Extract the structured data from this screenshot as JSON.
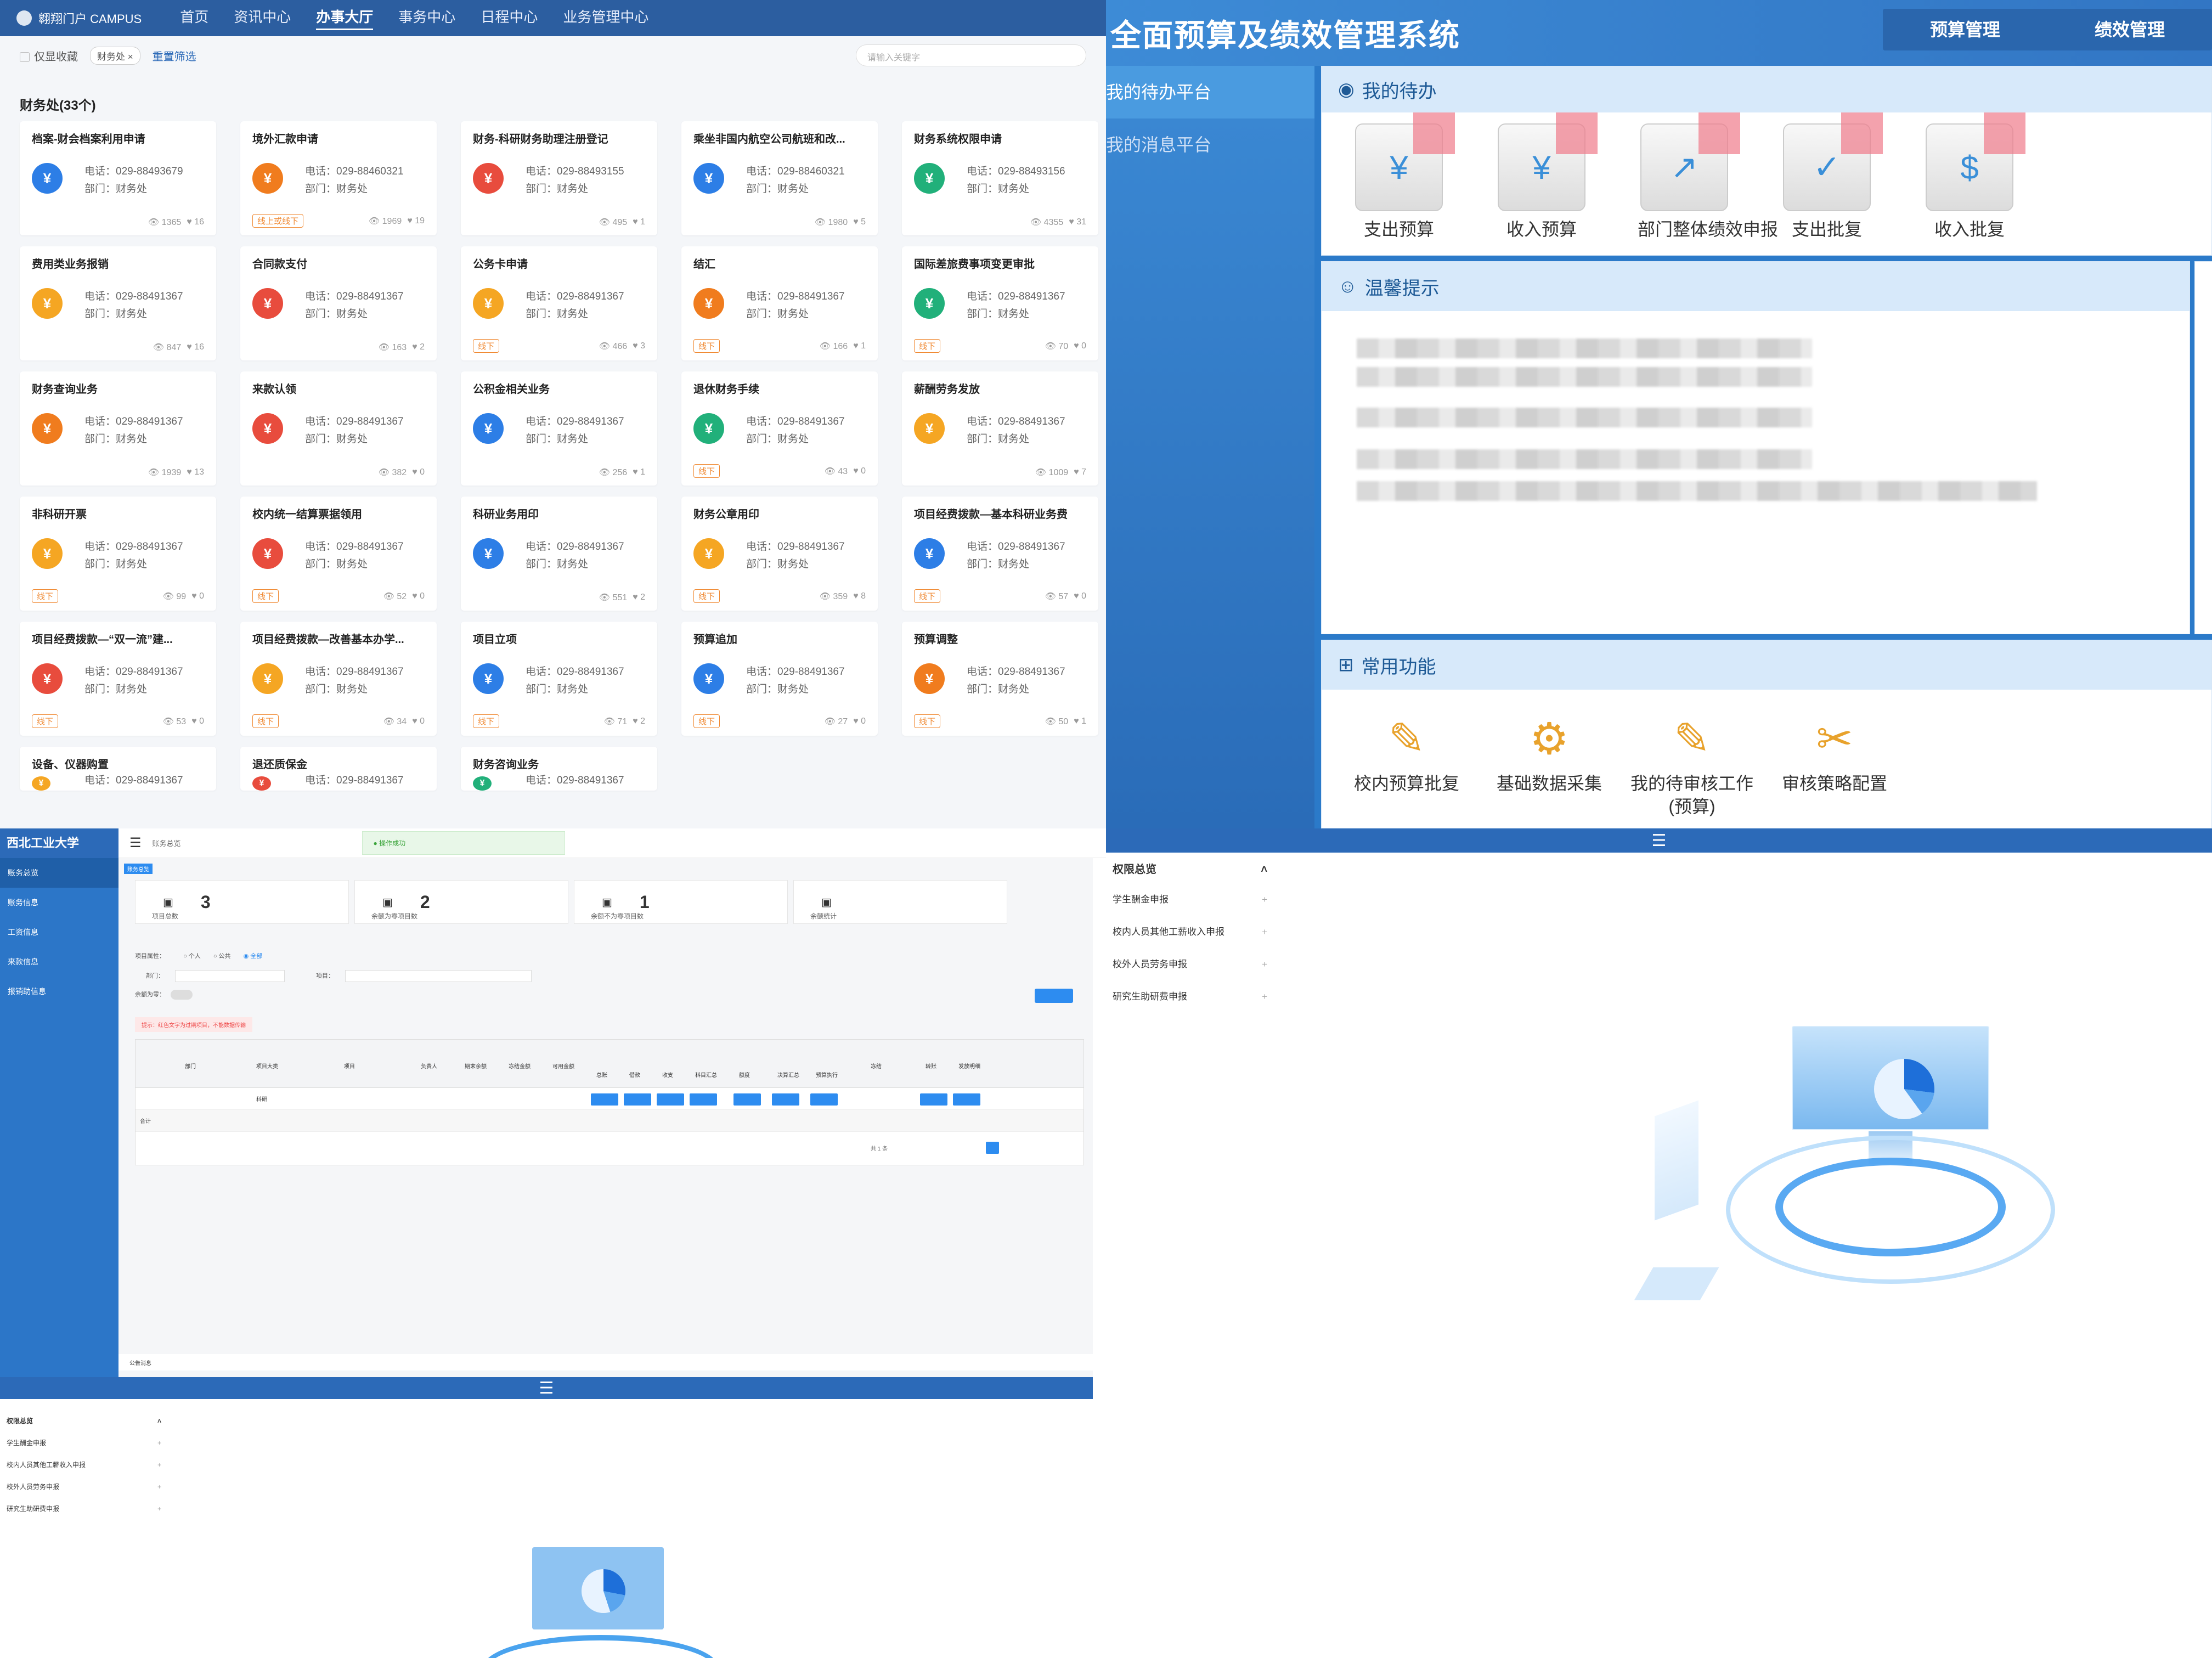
{
  "q1": {
    "brand": "翱翔门户 CAMPUS",
    "nav": [
      "首页",
      "资讯中心",
      "办事大厅",
      "事务中心",
      "日程中心",
      "业务管理中心"
    ],
    "filter": {
      "only_fav": "仅显收藏",
      "tag": "财务处 ×",
      "reset": "重置筛选",
      "search_placeholder": "请输入关键字"
    },
    "section": "财务处(33个)",
    "cards": [
      {
        "title": "档案-财会档案利用申请",
        "phone": "电话：029-88493679",
        "dept": "部门：财务处",
        "badge": "",
        "views": "1365",
        "likes": "16",
        "color": "#2d7ee6"
      },
      {
        "title": "境外汇款申请",
        "phone": "电话：029-88460321",
        "dept": "部门：财务处",
        "badge": "线上或线下",
        "views": "1969",
        "likes": "19",
        "color": "#f07c1e"
      },
      {
        "title": "财务-科研财务助理注册登记",
        "phone": "电话：029-88493155",
        "dept": "部门：财务处",
        "badge": "",
        "views": "495",
        "likes": "1",
        "color": "#e84c3d"
      },
      {
        "title": "乘坐非国内航空公司航班和改...",
        "phone": "电话：029-88460321",
        "dept": "部门：财务处",
        "badge": "",
        "views": "1980",
        "likes": "5",
        "color": "#2d7ee6"
      },
      {
        "title": "财务系统权限申请",
        "phone": "电话：029-88493156",
        "dept": "部门：财务处",
        "badge": "",
        "views": "4355",
        "likes": "31",
        "color": "#21b07a"
      },
      {
        "title": "费用类业务报销",
        "phone": "电话：029-88491367",
        "dept": "部门：财务处",
        "badge": "",
        "views": "847",
        "likes": "16",
        "color": "#f5a623"
      },
      {
        "title": "合同款支付",
        "phone": "电话：029-88491367",
        "dept": "部门：财务处",
        "badge": "",
        "views": "163",
        "likes": "2",
        "color": "#e84c3d"
      },
      {
        "title": "公务卡申请",
        "phone": "电话：029-88491367",
        "dept": "部门：财务处",
        "badge": "线下",
        "views": "466",
        "likes": "3",
        "color": "#f5a623"
      },
      {
        "title": "结汇",
        "phone": "电话：029-88491367",
        "dept": "部门：财务处",
        "badge": "线下",
        "views": "166",
        "likes": "1",
        "color": "#f07c1e"
      },
      {
        "title": "国际差旅费事项变更审批",
        "phone": "电话：029-88491367",
        "dept": "部门：财务处",
        "badge": "线下",
        "views": "70",
        "likes": "0",
        "color": "#21b07a"
      },
      {
        "title": "财务查询业务",
        "phone": "电话：029-88491367",
        "dept": "部门：财务处",
        "badge": "",
        "views": "1939",
        "likes": "13",
        "color": "#f07c1e"
      },
      {
        "title": "来款认领",
        "phone": "电话：029-88491367",
        "dept": "部门：财务处",
        "badge": "",
        "views": "382",
        "likes": "0",
        "color": "#e84c3d"
      },
      {
        "title": "公积金相关业务",
        "phone": "电话：029-88491367",
        "dept": "部门：财务处",
        "badge": "",
        "views": "256",
        "likes": "1",
        "color": "#2d7ee6"
      },
      {
        "title": "退休财务手续",
        "phone": "电话：029-88491367",
        "dept": "部门：财务处",
        "badge": "线下",
        "views": "43",
        "likes": "0",
        "color": "#21b07a"
      },
      {
        "title": "薪酬劳务发放",
        "phone": "电话：029-88491367",
        "dept": "部门：财务处",
        "badge": "",
        "views": "1009",
        "likes": "7",
        "color": "#f5a623"
      },
      {
        "title": "非科研开票",
        "phone": "电话：029-88491367",
        "dept": "部门：财务处",
        "badge": "线下",
        "views": "99",
        "likes": "0",
        "color": "#f5a623"
      },
      {
        "title": "校内统一结算票据领用",
        "phone": "电话：029-88491367",
        "dept": "部门：财务处",
        "badge": "线下",
        "views": "52",
        "likes": "0",
        "color": "#e84c3d"
      },
      {
        "title": "科研业务用印",
        "phone": "电话：029-88491367",
        "dept": "部门：财务处",
        "badge": "",
        "views": "551",
        "likes": "2",
        "color": "#2d7ee6"
      },
      {
        "title": "财务公章用印",
        "phone": "电话：029-88491367",
        "dept": "部门：财务处",
        "badge": "线下",
        "views": "359",
        "likes": "8",
        "color": "#f5a623"
      },
      {
        "title": "项目经费拨款—基本科研业务费",
        "phone": "电话：029-88491367",
        "dept": "部门：财务处",
        "badge": "线下",
        "views": "57",
        "likes": "0",
        "color": "#2d7ee6"
      },
      {
        "title": "项目经费拨款—“双一流”建...",
        "phone": "电话：029-88491367",
        "dept": "部门：财务处",
        "badge": "线下",
        "views": "53",
        "likes": "0",
        "color": "#e84c3d"
      },
      {
        "title": "项目经费拨款—改善基本办学...",
        "phone": "电话：029-88491367",
        "dept": "部门：财务处",
        "badge": "线下",
        "views": "34",
        "likes": "0",
        "color": "#f5a623"
      },
      {
        "title": "项目立项",
        "phone": "电话：029-88491367",
        "dept": "部门：财务处",
        "badge": "线下",
        "views": "71",
        "likes": "2",
        "color": "#2d7ee6"
      },
      {
        "title": "预算追加",
        "phone": "电话：029-88491367",
        "dept": "部门：财务处",
        "badge": "线下",
        "views": "27",
        "likes": "0",
        "color": "#2d7ee6"
      },
      {
        "title": "预算调整",
        "phone": "电话：029-88491367",
        "dept": "部门：财务处",
        "badge": "线下",
        "views": "50",
        "likes": "1",
        "color": "#f07c1e"
      },
      {
        "title": "设备、仪器购置",
        "phone": "电话：029-88491367",
        "dept": "",
        "badge": "",
        "views": "",
        "likes": "",
        "color": "#f5a623"
      },
      {
        "title": "退还质保金",
        "phone": "电话：029-88491367",
        "dept": "",
        "badge": "",
        "views": "",
        "likes": "",
        "color": "#e84c3d"
      },
      {
        "title": "财务咨询业务",
        "phone": "电话：029-88491367",
        "dept": "",
        "badge": "",
        "views": "",
        "likes": "",
        "color": "#21b07a"
      }
    ]
  },
  "q2": {
    "title": "全面预算及绩效管理系统",
    "menu": [
      "预算管理",
      "绩效管理"
    ],
    "side": [
      "我的待办平台",
      "我的消息平台"
    ],
    "todo_title": "我的待办",
    "todo": [
      "支出预算",
      "收入预算",
      "部门整体绩效申报",
      "支出批复",
      "收入批复"
    ],
    "tips_title": "温馨提示",
    "func_title": "常用功能",
    "func": [
      "校内预算批复",
      "基础数据采集",
      "我的待审核工作(预算)",
      "审核策略配置"
    ]
  },
  "q3": {
    "logo": "西北工业大学",
    "crumb": "账务总览",
    "toast": "操作成功",
    "side": [
      "账务总览",
      "账务信息",
      "工资信息",
      "来款信息",
      "报销助信息"
    ],
    "stats": [
      {
        "num": "3",
        "label": "项目总数"
      },
      {
        "num": "2",
        "label": "余额为零项目数"
      },
      {
        "num": "1",
        "label": "余额不为零项目数"
      },
      {
        "num": "",
        "label": "余额统计"
      }
    ],
    "filters": {
      "prop": "项目属性：",
      "opt": [
        "个人",
        "公共",
        "全部"
      ],
      "dept": "部门：",
      "proj": "项目：",
      "zero": "余额为零："
    },
    "tip": "提示：红色文字为过期项目，不能数据传输",
    "headers": [
      "部门",
      "项目大类",
      "项目",
      "负责人",
      "期末余额",
      "冻结金额",
      "可用金额",
      "总账",
      "借款",
      "收支",
      "科目汇总",
      "额度",
      "决算汇总",
      "预算执行",
      "冻结",
      "转账",
      "发放明细"
    ],
    "row_cat": "科研",
    "total": "合计",
    "pager": "共 1 条",
    "notice": "公告消息"
  },
  "q4": {
    "side_title": "权限总览",
    "items": [
      "学生酬金申报",
      "校内人员其他工薪收入申报",
      "校外人员劳务申报",
      "研究生助研费申报"
    ]
  }
}
